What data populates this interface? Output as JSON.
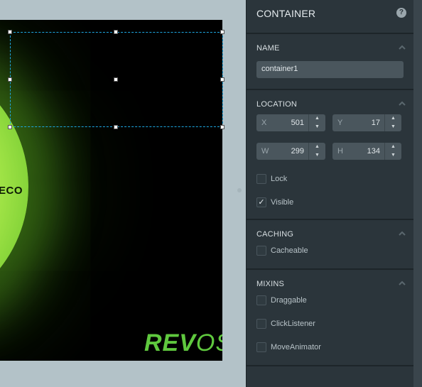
{
  "canvas": {
    "eco_text": "ECO",
    "brand_rev": "REV",
    "brand_os": "OS"
  },
  "panel": {
    "title": "CONTAINER",
    "help_icon": "question-circle-icon",
    "name_section": {
      "header": "NAME",
      "value": "container1"
    },
    "location_section": {
      "header": "LOCATION",
      "x_label": "X",
      "x_value": "501",
      "y_label": "Y",
      "y_value": "17",
      "w_label": "W",
      "w_value": "299",
      "h_label": "H",
      "h_value": "134",
      "lock_label": "Lock",
      "lock_checked": false,
      "visible_label": "Visible",
      "visible_checked": true
    },
    "caching_section": {
      "header": "CACHING",
      "cacheable_label": "Cacheable"
    },
    "mixins_section": {
      "header": "MIXINS",
      "items": [
        "Draggable",
        "ClickListener",
        "MoveAnimator"
      ]
    }
  },
  "colors": {
    "selection": "#1ea7e1",
    "brand_green": "#5fc83e",
    "panel_bg": "#2b353b"
  }
}
